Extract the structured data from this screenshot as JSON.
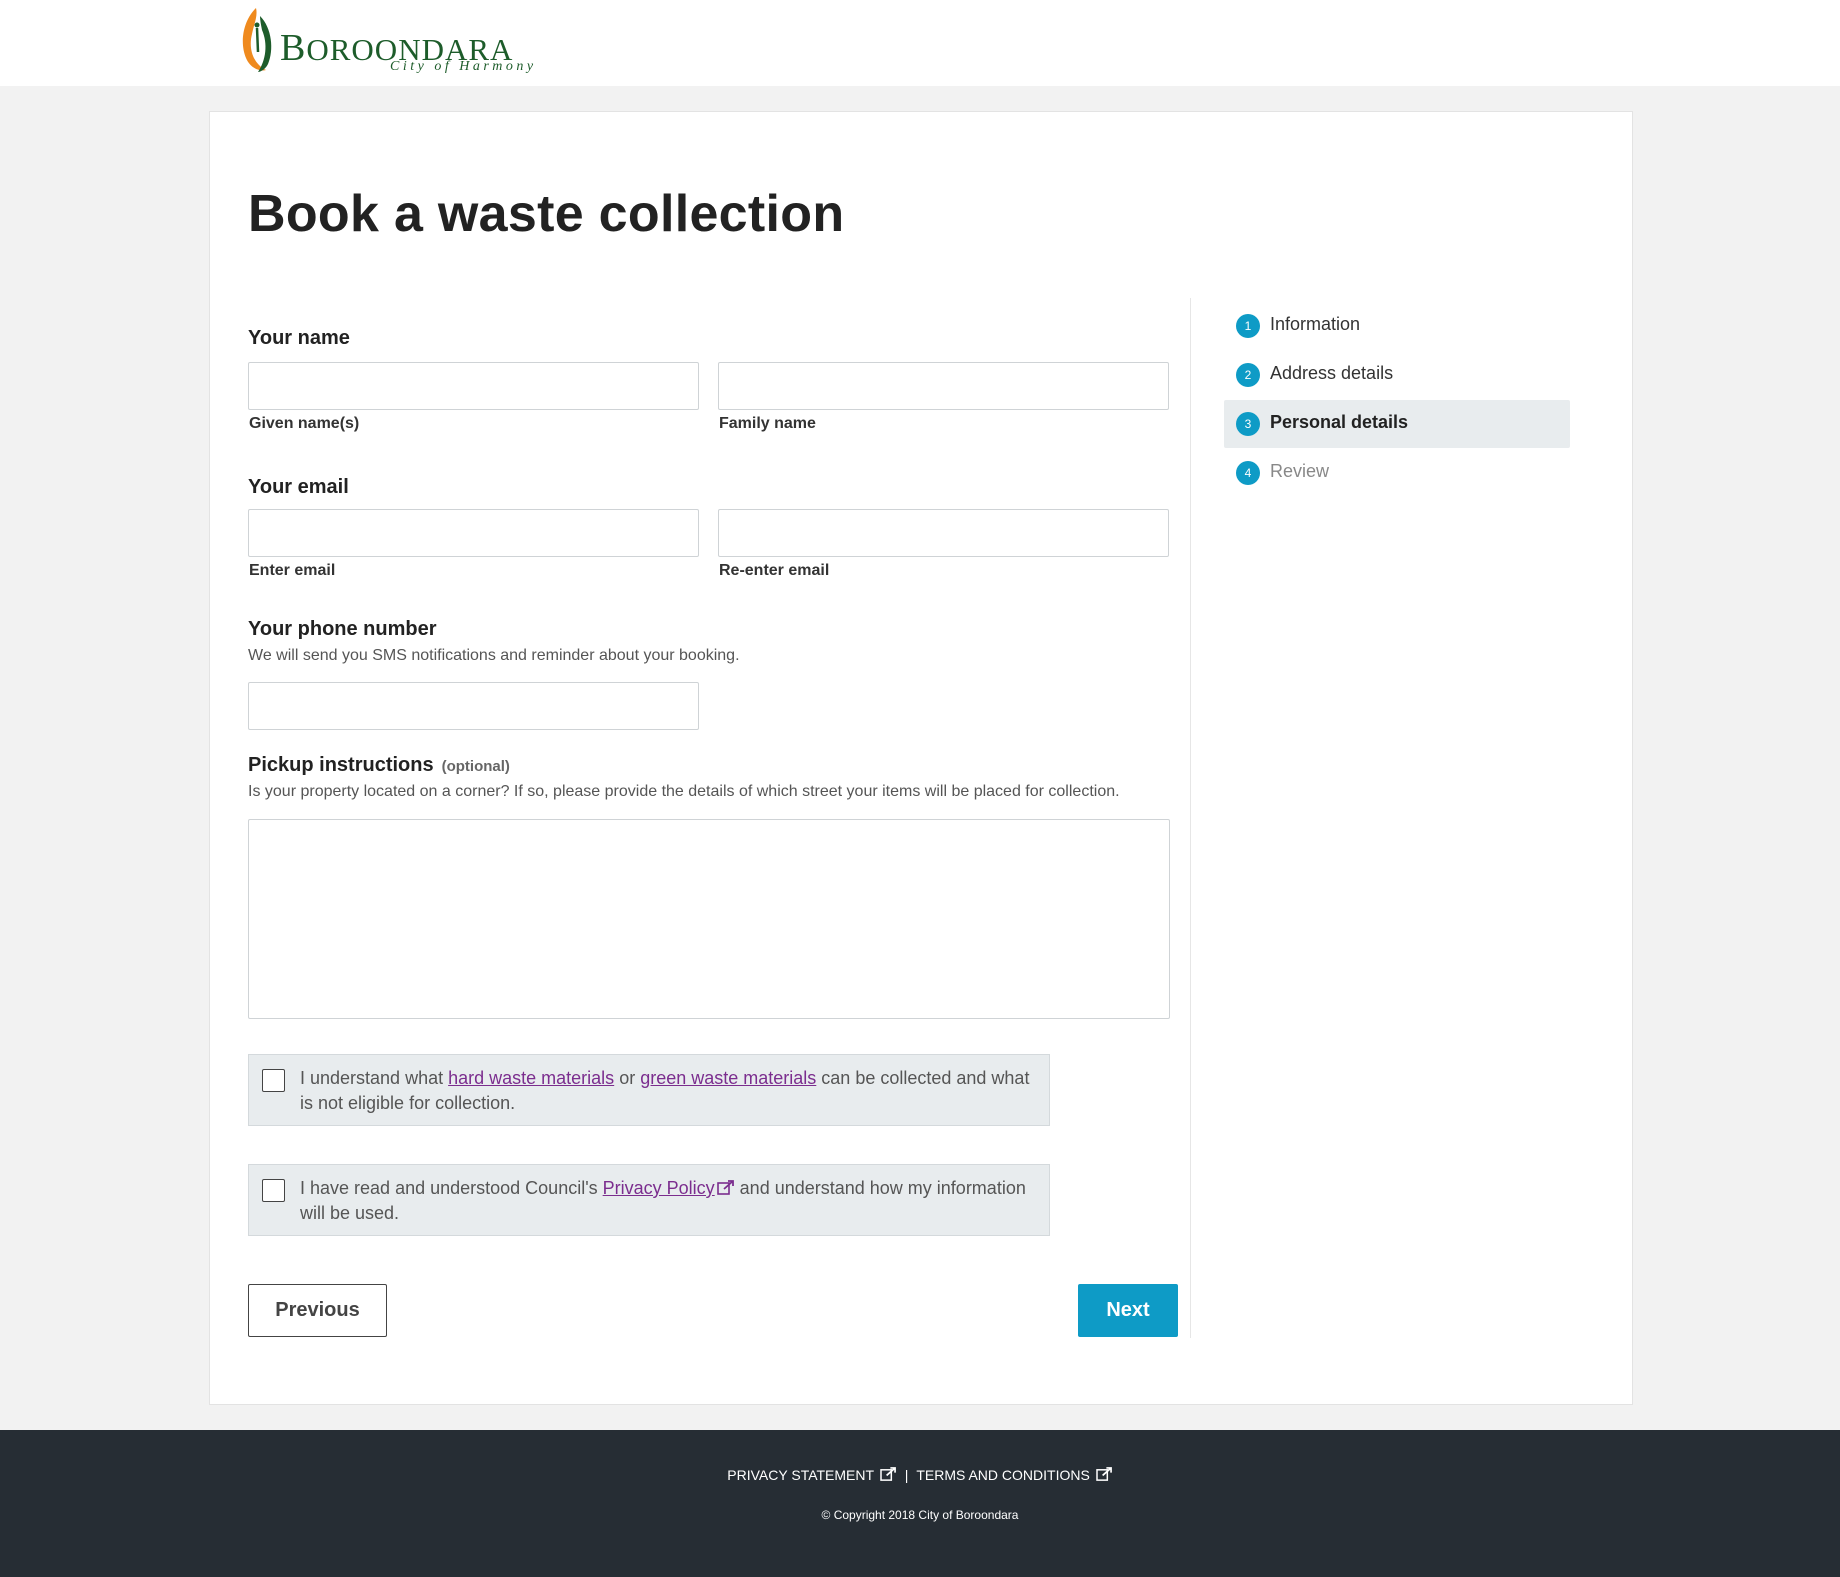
{
  "brand": {
    "name_initial": "B",
    "name_rest": "OROONDARA",
    "tagline": "City of Harmony"
  },
  "page": {
    "title": "Book a waste collection"
  },
  "form": {
    "name": {
      "heading": "Your name",
      "given_label": "Given name(s)",
      "given_value": "",
      "family_label": "Family name",
      "family_value": ""
    },
    "email": {
      "heading": "Your email",
      "enter_label": "Enter email",
      "enter_value": "",
      "reenter_label": "Re-enter email",
      "reenter_value": ""
    },
    "phone": {
      "heading": "Your phone number",
      "help": "We will send you SMS notifications and reminder about your booking.",
      "value": ""
    },
    "pickup": {
      "heading": "Pickup instructions",
      "optional": "(optional)",
      "help": "Is your property located on a corner? If so, please provide the details of which street your items will be placed for collection.",
      "value": ""
    },
    "consent_waste": {
      "checked": false,
      "text_1": "I understand what ",
      "link_1": "hard waste materials",
      "text_2": " or ",
      "link_2": "green waste materials",
      "text_3": " can be collected and what is not eligible for collection."
    },
    "consent_privacy": {
      "checked": false,
      "text_1": "I have read and understood Council's ",
      "link": "Privacy Policy",
      "text_2": " and understand how my information will be used."
    }
  },
  "buttons": {
    "previous": "Previous",
    "next": "Next"
  },
  "steps": [
    {
      "number": "1",
      "label": "Information",
      "state": "done"
    },
    {
      "number": "2",
      "label": "Address details",
      "state": "done"
    },
    {
      "number": "3",
      "label": "Personal details",
      "state": "active"
    },
    {
      "number": "4",
      "label": "Review",
      "state": "future"
    }
  ],
  "footer": {
    "privacy": "PRIVACY STATEMENT",
    "separator": "|",
    "terms": "TERMS AND CONDITIONS",
    "copyright": "© Copyright 2018 City of Boroondara"
  },
  "colors": {
    "accent": "#0e9bc6",
    "link": "#7b2d8e",
    "footer_bg": "#262d34",
    "brand_green": "#1d5c2a",
    "brand_orange": "#ef8a1e"
  },
  "icons": {
    "external_link": "external-link-icon",
    "logo_mark": "flame-leaf-icon"
  }
}
